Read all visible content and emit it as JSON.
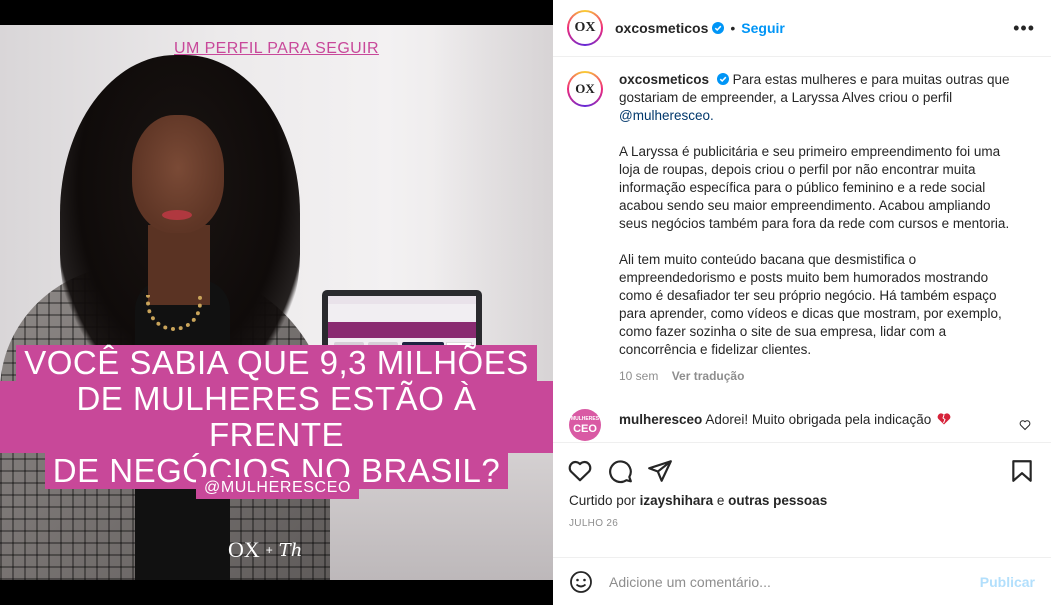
{
  "media": {
    "topline": "UM PERFIL PARA SEGUIR",
    "headline": [
      "VOCÊ SABIA QUE 9,3 MILHÕES",
      "DE MULHERES ESTÃO À FRENTE",
      "DE NEGÓCIOS NO BRASIL?"
    ],
    "handle": "@MULHERESCEO",
    "logo": "OX",
    "logo_plus": "+",
    "signature": "Th"
  },
  "header": {
    "avatar_text": "OX",
    "username": "oxcosmeticos",
    "dot": "•",
    "follow": "Seguir",
    "more": "•••"
  },
  "caption": {
    "avatar_text": "OX",
    "username": "oxcosmeticos",
    "p1": "Para estas mulheres e para muitas outras que gostariam de empreender, a Laryssa Alves criou o perfil",
    "mention": "@mulheresceo.",
    "p2": "A Laryssa é publicitária e seu primeiro empreendimento foi uma loja de roupas, depois criou o perfil por não encontrar muita informação específica para o público feminino e a rede social acabou sendo seu maior empreendimento. Acabou ampliando seus negócios também para fora da rede com cursos e mentoria.",
    "p3": "Ali tem muito conteúdo bacana que desmistifica o empreendedorismo e posts muito bem humorados mostrando como é desafiador ter seu próprio negócio. Há também espaço para aprender, como vídeos e dicas que mostram, por exemplo, como fazer sozinha o site de sua empresa, lidar com a concorrência e fidelizar clientes.",
    "time": "10 sem",
    "translate": "Ver tradução"
  },
  "comment": {
    "avatar_line1": "MULHERES",
    "avatar_line2": "CEO",
    "username": "mulheresceo",
    "text": "Adorei! Muito obrigada pela indicação"
  },
  "likes": {
    "prefix": "Curtido por",
    "user": "izayshihara",
    "conj": "e",
    "others": "outras pessoas"
  },
  "date": "JULHO 26",
  "add_comment": {
    "placeholder": "Adicione um comentário...",
    "post": "Publicar"
  },
  "colors": {
    "brand_pink": "#c84899",
    "link_blue": "#0095f6",
    "publish_disabled": "#b2dffc"
  }
}
